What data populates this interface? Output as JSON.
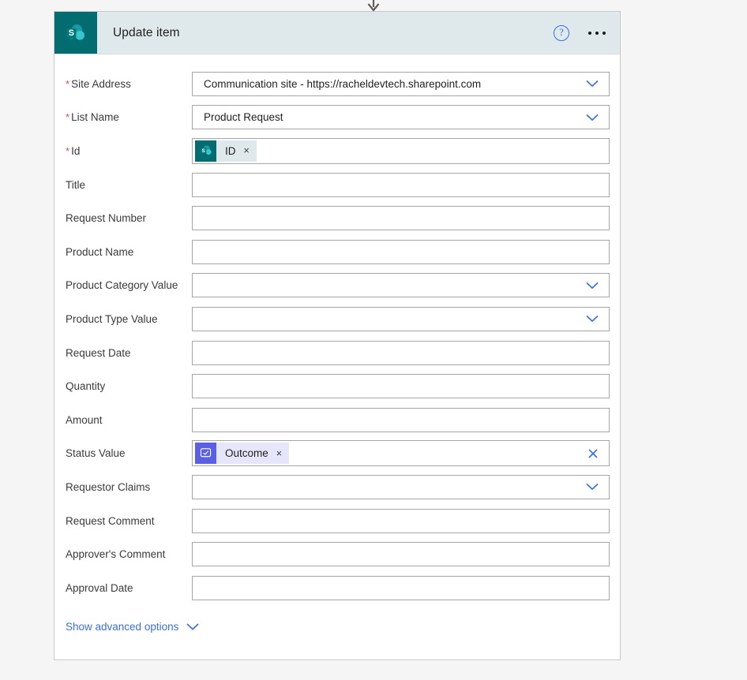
{
  "connector": {
    "icon": "arrow-down-icon"
  },
  "header": {
    "logo_icon": "sharepoint-logo-icon",
    "title": "Update item",
    "help_icon": "help-question-icon",
    "help_label": "?",
    "more_icon": "ellipsis-more-icon"
  },
  "colors": {
    "sharepoint_teal": "#036c70",
    "header_bg": "#dfe9ec",
    "accent_blue": "#3b6ee0",
    "required_red": "#e04b4b",
    "approval_purple": "#5b5fe3",
    "page_bg": "#f5f5f5"
  },
  "fields": [
    {
      "label": "Site Address",
      "required": true,
      "type": "dropdown",
      "value": "Communication site - https://racheldevtech.sharepoint.com",
      "chevron_icon": "chevron-down-icon"
    },
    {
      "label": "List Name",
      "required": true,
      "type": "dropdown",
      "value": "Product Request",
      "chevron_icon": "chevron-down-icon"
    },
    {
      "label": "Id",
      "required": true,
      "type": "token",
      "value": "",
      "token": {
        "label": "ID",
        "icon": "sharepoint-token-icon",
        "remove_label": "×",
        "style": "sp"
      }
    },
    {
      "label": "Title",
      "required": false,
      "type": "text",
      "value": ""
    },
    {
      "label": "Request Number",
      "required": false,
      "type": "text",
      "value": ""
    },
    {
      "label": "Product Name",
      "required": false,
      "type": "text",
      "value": ""
    },
    {
      "label": "Product Category Value",
      "required": false,
      "type": "dropdown",
      "value": "",
      "chevron_icon": "chevron-down-icon"
    },
    {
      "label": "Product Type Value",
      "required": false,
      "type": "dropdown",
      "value": "",
      "chevron_icon": "chevron-down-icon"
    },
    {
      "label": "Request Date",
      "required": false,
      "type": "text",
      "value": ""
    },
    {
      "label": "Quantity",
      "required": false,
      "type": "text",
      "value": ""
    },
    {
      "label": "Amount",
      "required": false,
      "type": "text",
      "value": ""
    },
    {
      "label": "Status Value",
      "required": false,
      "type": "token",
      "value": "",
      "token": {
        "label": "Outcome",
        "icon": "approvals-outcome-icon",
        "remove_label": "×",
        "style": "approval"
      },
      "clear_icon": "clear-x-icon"
    },
    {
      "label": "Requestor Claims",
      "required": false,
      "type": "dropdown",
      "value": "",
      "chevron_icon": "chevron-down-icon"
    },
    {
      "label": "Request Comment",
      "required": false,
      "type": "text",
      "value": ""
    },
    {
      "label": "Approver's Comment",
      "required": false,
      "type": "text",
      "value": ""
    },
    {
      "label": "Approval Date",
      "required": false,
      "type": "text",
      "value": ""
    }
  ],
  "advanced": {
    "label": "Show advanced options",
    "chevron_icon": "chevron-down-icon"
  }
}
